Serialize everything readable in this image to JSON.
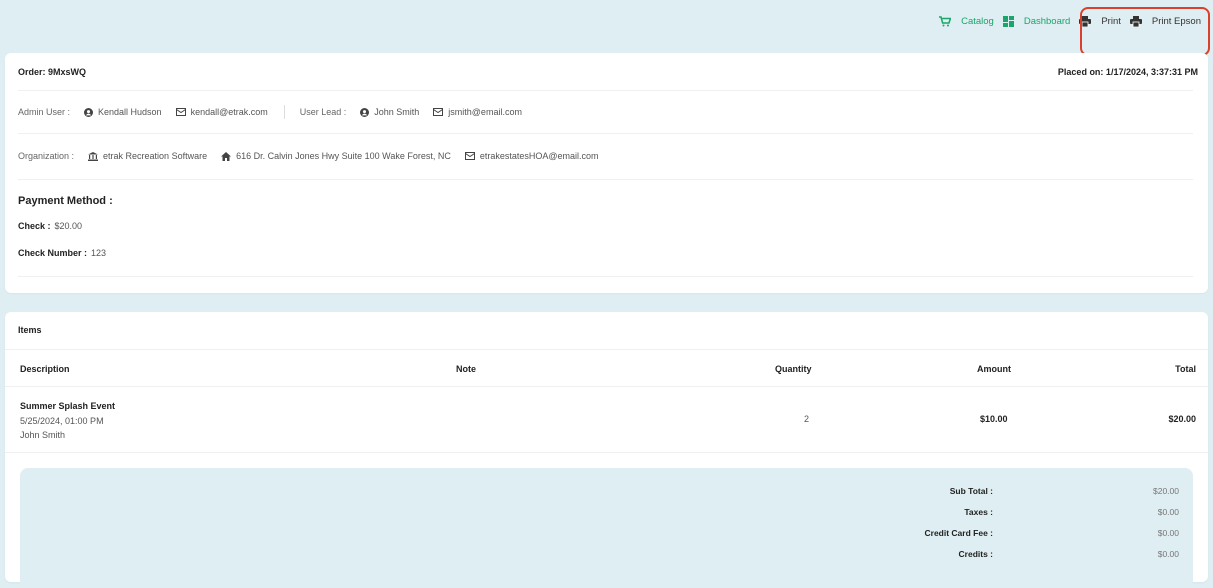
{
  "nav": {
    "catalog": "Catalog",
    "dashboard": "Dashboard",
    "print": "Print",
    "print_epson": "Print Epson"
  },
  "order": {
    "id_label": "Order: 9MxsWQ",
    "placed_on": "Placed on: 1/17/2024, 3:37:31 PM",
    "admin_user_label": "Admin User :",
    "admin_user_name": "Kendall Hudson",
    "admin_user_email": "kendall@etrak.com",
    "user_lead_label": "User Lead :",
    "user_lead_name": "John Smith",
    "user_lead_email": "jsmith@email.com",
    "org_label": "Organization :",
    "org_name": "etrak Recreation Software",
    "org_address": "616 Dr. Calvin Jones Hwy Suite 100 Wake Forest, NC",
    "org_email": "etrakestatesHOA@email.com",
    "payment_title": "Payment Method :",
    "check_label": "Check :",
    "check_value": "$20.00",
    "check_number_label": "Check Number :",
    "check_number_value": "123"
  },
  "items": {
    "title": "Items",
    "headers": {
      "description": "Description",
      "note": "Note",
      "quantity": "Quantity",
      "amount": "Amount",
      "total": "Total"
    },
    "rows": [
      {
        "name": "Summer Splash Event",
        "date": "5/25/2024, 01:00 PM",
        "person": "John Smith",
        "note": "",
        "quantity": "2",
        "amount": "$10.00",
        "total": "$20.00"
      }
    ]
  },
  "summary": {
    "subtotal_label": "Sub Total :",
    "subtotal_value": "$20.00",
    "taxes_label": "Taxes :",
    "taxes_value": "$0.00",
    "cc_fee_label": "Credit Card Fee :",
    "cc_fee_value": "$0.00",
    "credits_label": "Credits :",
    "credits_value": "$0.00"
  },
  "colors": {
    "background": "#dfeef2",
    "accent_green": "#1aa56a",
    "highlight_red": "#d9412d"
  },
  "icons": [
    "cart-icon",
    "dashboard-icon",
    "printer-icon",
    "user-circle-icon",
    "mail-icon",
    "bank-icon",
    "home-icon"
  ]
}
